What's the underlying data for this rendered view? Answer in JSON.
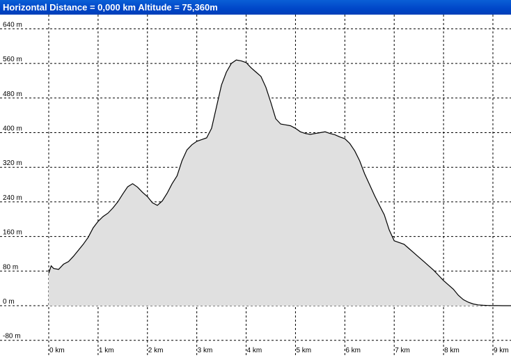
{
  "header": {
    "text": "Horizontal Distance = 0,000 km    Altitude =  75,360m"
  },
  "colors": {
    "header_bg": "#0046c8",
    "fill": "#e0e0e0",
    "line": "#000000",
    "grid": "#000000"
  },
  "chart_data": {
    "type": "area",
    "title": "",
    "xlabel": "",
    "ylabel": "",
    "xlim": [
      0,
      9.45
    ],
    "ylim": [
      -80,
      680
    ],
    "grid": true,
    "x_ticks": [
      0,
      1,
      2,
      3,
      4,
      5,
      6,
      7,
      8,
      9
    ],
    "x_tick_labels": [
      "0 km",
      "1 km",
      "2 km",
      "3 km",
      "4 km",
      "5 km",
      "6 km",
      "7 km",
      "8 km",
      "9 km"
    ],
    "y_ticks": [
      -80,
      0,
      80,
      160,
      240,
      320,
      400,
      480,
      560,
      640
    ],
    "y_tick_labels": [
      "-80 m",
      "0 m",
      "80 m",
      "160 m",
      "240 m",
      "320 m",
      "400 m",
      "480 m",
      "560 m",
      "640 m"
    ],
    "series": [
      {
        "x": [
          0,
          0.02,
          0.05,
          0.1,
          0.2,
          0.3,
          0.4,
          0.5,
          0.6,
          0.7,
          0.8,
          0.9,
          1.0,
          1.1,
          1.2,
          1.3,
          1.4,
          1.5,
          1.6,
          1.7,
          1.8,
          1.9,
          2.0,
          2.1,
          2.2,
          2.3,
          2.4,
          2.5,
          2.6,
          2.7,
          2.8,
          2.9,
          3.0,
          3.1,
          3.2,
          3.3,
          3.4,
          3.5,
          3.6,
          3.7,
          3.8,
          3.9,
          4.0,
          4.1,
          4.2,
          4.3,
          4.4,
          4.5,
          4.6,
          4.7,
          4.8,
          4.9,
          5.0,
          5.1,
          5.2,
          5.3,
          5.4,
          5.5,
          5.6,
          5.7,
          5.8,
          5.9,
          6.0,
          6.1,
          6.2,
          6.3,
          6.4,
          6.5,
          6.6,
          6.7,
          6.8,
          6.9,
          7.0,
          7.1,
          7.2,
          7.3,
          7.4,
          7.5,
          7.6,
          7.7,
          7.8,
          7.9,
          8.0,
          8.1,
          8.2,
          8.3,
          8.4,
          8.5,
          8.6,
          8.7,
          8.8,
          8.9,
          9.0,
          9.1,
          9.2,
          9.3,
          9.4
        ],
        "y": [
          75,
          82,
          92,
          86,
          84,
          96,
          102,
          114,
          128,
          142,
          158,
          180,
          195,
          206,
          214,
          226,
          240,
          258,
          275,
          282,
          274,
          262,
          252,
          238,
          232,
          242,
          260,
          282,
          300,
          335,
          360,
          372,
          380,
          384,
          388,
          410,
          460,
          510,
          540,
          560,
          568,
          566,
          562,
          550,
          540,
          530,
          505,
          470,
          432,
          420,
          418,
          416,
          410,
          402,
          398,
          396,
          398,
          400,
          402,
          398,
          395,
          390,
          386,
          375,
          358,
          335,
          305,
          280,
          255,
          232,
          210,
          175,
          150,
          146,
          142,
          132,
          122,
          112,
          102,
          92,
          82,
          70,
          58,
          48,
          38,
          24,
          14,
          8,
          4,
          2,
          1,
          0.5,
          0.2,
          0.1,
          0.05,
          0.02,
          0
        ]
      }
    ]
  }
}
